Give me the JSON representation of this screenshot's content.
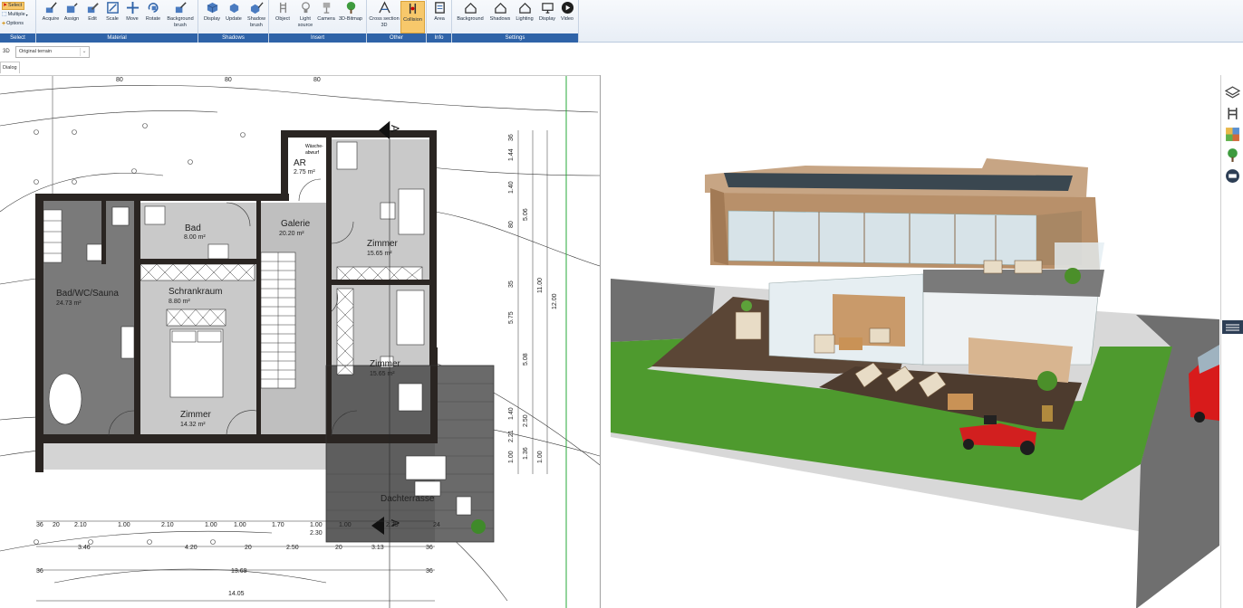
{
  "ribbon": {
    "select_group": {
      "select": "Select",
      "multiple": "Multiple",
      "options": "Options",
      "label": "Select"
    },
    "material": {
      "label": "Material",
      "tools": [
        "Acquire",
        "Assign",
        "Edit",
        "Scale",
        "Move",
        "Rotate",
        "Background brush"
      ]
    },
    "shadows": {
      "label": "Shadows",
      "tools": [
        "Display",
        "Update",
        "Shadow brush"
      ]
    },
    "insert": {
      "label": "Insert",
      "tools": [
        "Object",
        "Light source",
        "Camera",
        "3D-Bitmap"
      ]
    },
    "other": {
      "label": "Other",
      "tools": [
        "Cross section 3D",
        "Collision"
      ]
    },
    "info": {
      "label": "Info",
      "tools": [
        "Area"
      ]
    },
    "settings": {
      "label": "Settings",
      "tools": [
        "Background",
        "Shadows",
        "Lighting",
        "Display",
        "Video"
      ]
    }
  },
  "subbar": {
    "view_label": "3D",
    "terrain_value": "Original terrain",
    "dialog_tab": "Dialog"
  },
  "plan": {
    "rooms": [
      {
        "name": "Bad",
        "area": "8.00 m²"
      },
      {
        "name": "Galerie",
        "area": "20.20 m²"
      },
      {
        "name": "AR",
        "area": "2.75 m²"
      },
      {
        "name": "Zimmer",
        "area": "15.65 m²"
      },
      {
        "name": "Bad/WC/Sauna",
        "area": "24.73 m²"
      },
      {
        "name": "Schrankraum",
        "area": "8.80 m²"
      },
      {
        "name": "Zimmer",
        "area": "15.65 m²"
      },
      {
        "name": "Zimmer",
        "area": "14.32 m²"
      },
      {
        "name": "Dachterrasse",
        "area": ""
      }
    ],
    "washer_note": [
      "Wäsche-",
      "abwurf"
    ],
    "section_marker": "A",
    "top_dims": [
      "80",
      "80",
      "80"
    ],
    "bottom_dims_row1": [
      "36",
      "20",
      "2.10",
      "1.00",
      "2.10",
      "1.00",
      "1.00",
      "1.70",
      "1.00",
      "1.00",
      "2.35",
      "24"
    ],
    "bottom_dims_row2": [
      "3.46",
      "4.20",
      "20",
      "2.50",
      "2.30",
      "20",
      "3.13",
      "36"
    ],
    "bottom_dims_row3": [
      "36",
      "13.69",
      "36"
    ],
    "bottom_dims_row4": [
      "14.05"
    ],
    "right_dims": [
      "36",
      "1.44",
      "1.40",
      "80",
      "5.06",
      "35",
      "5.75",
      "11.00",
      "12.00",
      "5.08",
      "1.40",
      "2.21",
      "2.50",
      "1.36",
      "1.00",
      "1.00"
    ]
  },
  "colors": {
    "ribbon_group_label": "#2f63a8",
    "active_tool": "#f7c86b",
    "wall": "#2a2522",
    "floor": "#c8c8c8",
    "grass": "#4e9a2e",
    "road": "#6f6f6f",
    "deck": "#5b4636",
    "wood": "#b8906a"
  },
  "icons": {
    "side_toolbar": [
      "layers-icon",
      "chair-icon",
      "materials-icon",
      "tree-icon",
      "catalog-icon"
    ]
  }
}
